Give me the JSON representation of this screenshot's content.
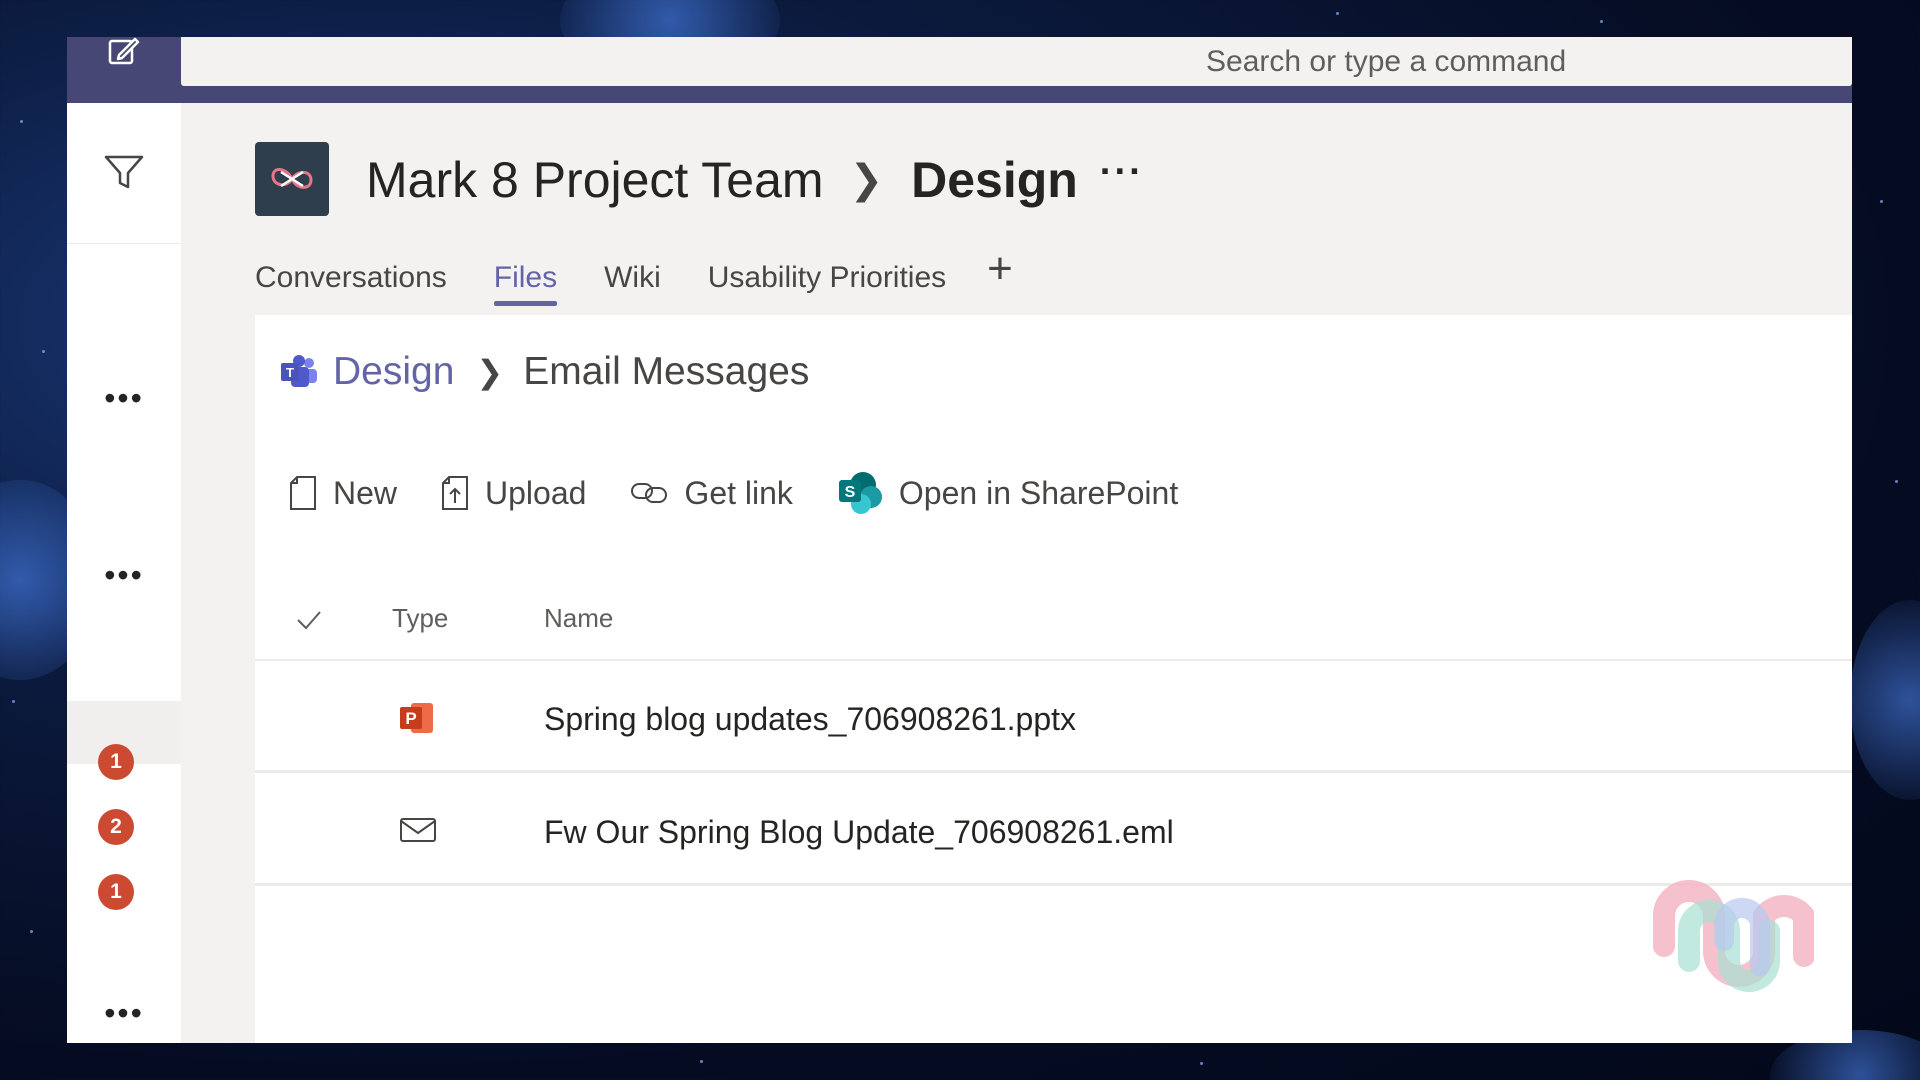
{
  "search": {
    "placeholder": "Search or type a command"
  },
  "rail": {
    "badges": [
      "1",
      "2",
      "1"
    ]
  },
  "team": {
    "name": "Mark 8 Project Team",
    "channel": "Design"
  },
  "tabs": [
    {
      "label": "Conversations",
      "active": false
    },
    {
      "label": "Files",
      "active": true
    },
    {
      "label": "Wiki",
      "active": false
    },
    {
      "label": "Usability Priorities",
      "active": false
    }
  ],
  "breadcrumb": {
    "root": "Design",
    "current": "Email Messages"
  },
  "toolbar": {
    "new_label": "New",
    "upload_label": "Upload",
    "get_link_label": "Get link",
    "open_sharepoint_label": "Open in SharePoint"
  },
  "list": {
    "columns": {
      "type": "Type",
      "name": "Name"
    },
    "rows": [
      {
        "type_icon": "powerpoint-icon",
        "name": "Spring blog updates_706908261.pptx"
      },
      {
        "type_icon": "email-icon",
        "name": "Fw Our Spring Blog Update_706908261.eml"
      }
    ]
  },
  "colors": {
    "brand": "#6264a7",
    "topbar": "#464775",
    "badge": "#cc4a31",
    "powerpoint": "#d35230",
    "sharepoint": "#038387"
  }
}
